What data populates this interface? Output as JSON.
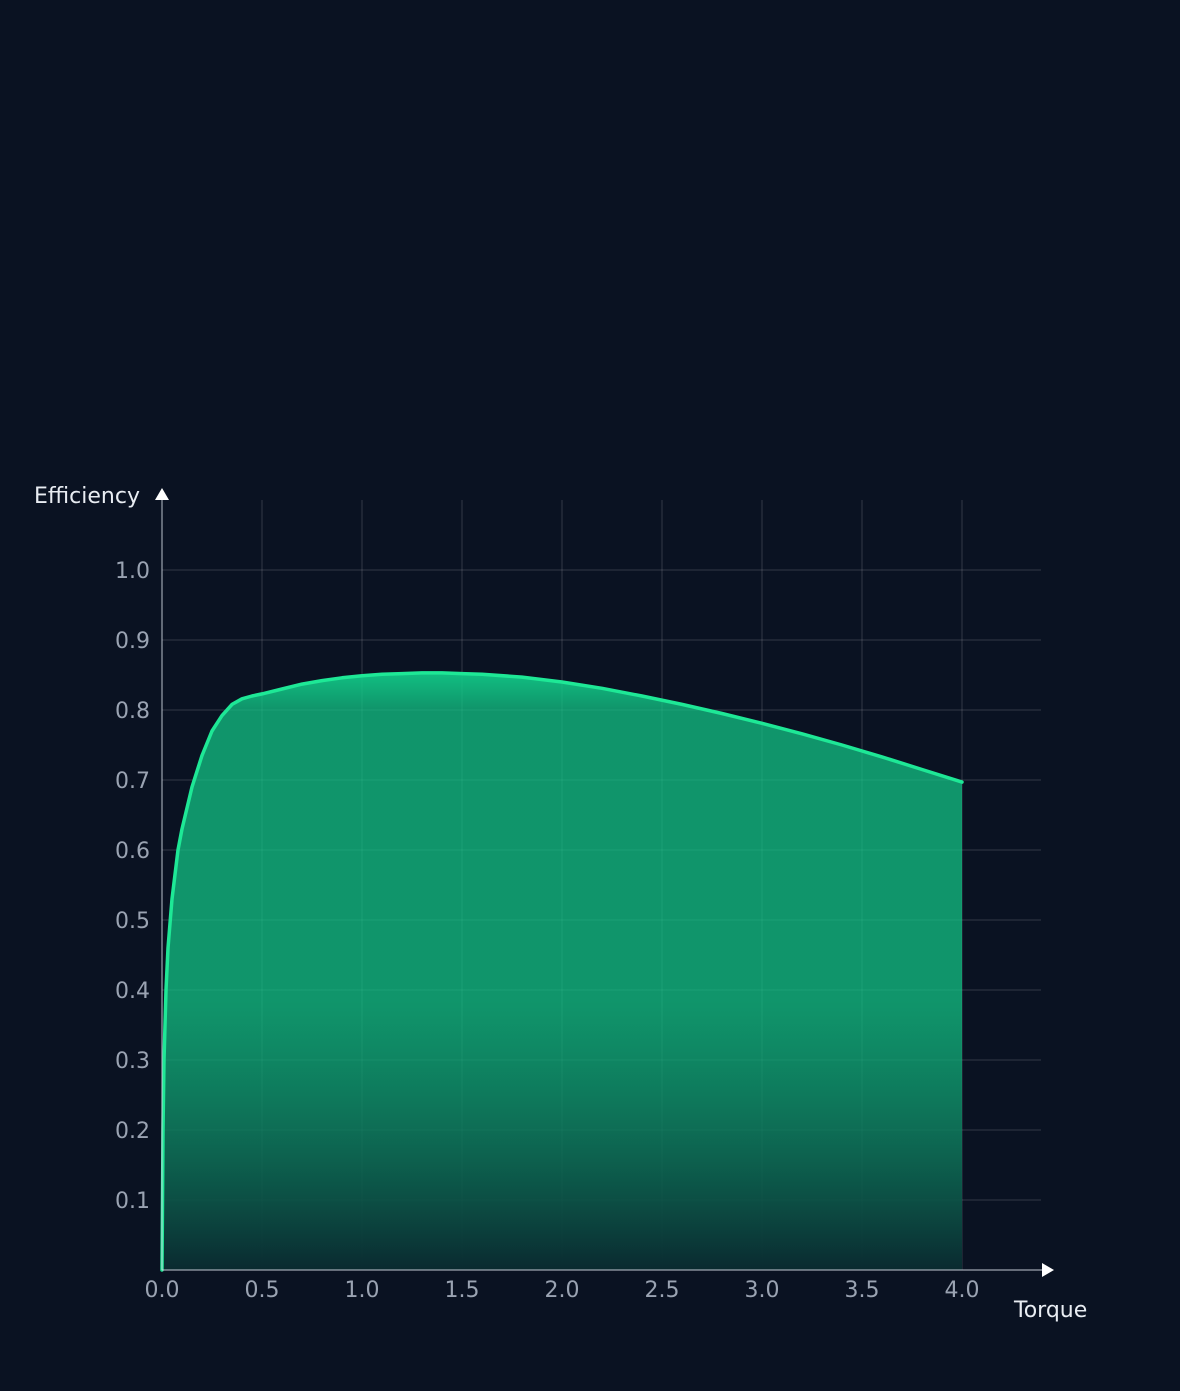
{
  "colors": {
    "background": "#0a1222",
    "line": "#1ee896",
    "fill_top": "#12c887",
    "fill_bottom": "#0a2a30",
    "tick_text": "#9aa3b2",
    "axis_title": "#e8ecf2"
  },
  "chart_data": {
    "type": "area",
    "title": "",
    "xlabel": "Torque",
    "ylabel": "Efficiency",
    "xlim": [
      0,
      4.4
    ],
    "ylim": [
      0,
      1.1
    ],
    "x_ticks": [
      "0.0",
      "0.5",
      "1.0",
      "1.5",
      "2.0",
      "2.5",
      "3.0",
      "3.5",
      "4.0"
    ],
    "y_ticks": [
      "0.1",
      "0.2",
      "0.3",
      "0.4",
      "0.5",
      "0.6",
      "0.7",
      "0.8",
      "0.9",
      "1.0"
    ],
    "grid": true,
    "series": [
      {
        "x": [
          0.0,
          0.005,
          0.01,
          0.02,
          0.03,
          0.05,
          0.08,
          0.1,
          0.15,
          0.2,
          0.25,
          0.3,
          0.35,
          0.4,
          0.45,
          0.5,
          0.6,
          0.7,
          0.8,
          0.9,
          1.0,
          1.1,
          1.2,
          1.3,
          1.4,
          1.5,
          1.6,
          1.8,
          2.0,
          2.2,
          2.4,
          2.6,
          2.8,
          3.0,
          3.2,
          3.4,
          3.6,
          3.8,
          4.0
        ],
        "y": [
          0.0,
          0.2,
          0.3,
          0.4,
          0.46,
          0.53,
          0.6,
          0.63,
          0.69,
          0.735,
          0.77,
          0.792,
          0.808,
          0.816,
          0.82,
          0.823,
          0.83,
          0.837,
          0.842,
          0.846,
          0.849,
          0.851,
          0.852,
          0.853,
          0.853,
          0.852,
          0.851,
          0.847,
          0.84,
          0.831,
          0.82,
          0.808,
          0.795,
          0.781,
          0.766,
          0.75,
          0.733,
          0.715,
          0.697
        ]
      }
    ]
  }
}
